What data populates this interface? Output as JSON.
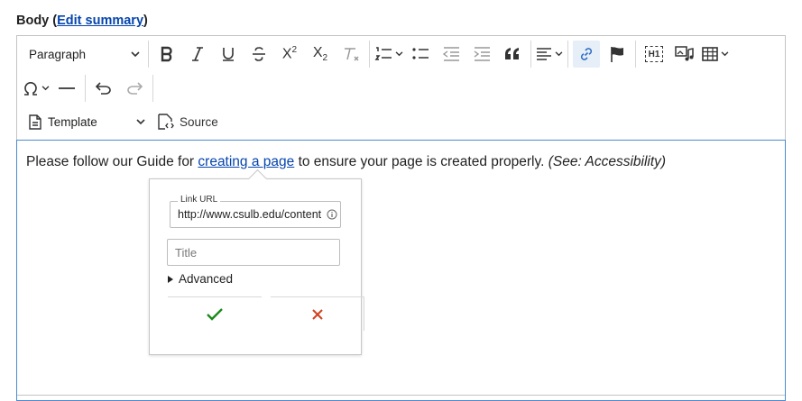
{
  "field": {
    "label_prefix": "Body (",
    "edit_summary_link": "Edit summary",
    "label_suffix": ")"
  },
  "toolbar": {
    "heading_dropdown": "Paragraph",
    "template_dropdown": "Template",
    "source_label": "Source",
    "superscript_glyph": "X",
    "superscript_mark": "2",
    "subscript_glyph": "X",
    "subscript_mark": "2",
    "heading_icon_label": "H1"
  },
  "content": {
    "text_before": "Please follow our Guide for ",
    "link_text": "creating a page",
    "text_after": " to ensure your page is created properly. ",
    "italic_note": "(See: Accessibility)"
  },
  "link_balloon": {
    "url_label": "Link URL",
    "url_value": "http://www.csulb.edu/content",
    "title_placeholder": "Title",
    "advanced_label": "Advanced"
  },
  "colors": {
    "link": "#0645ad",
    "focus_border": "#4f8bd1",
    "save_check": "#1a8a1a",
    "cancel_x": "#d2401e"
  }
}
